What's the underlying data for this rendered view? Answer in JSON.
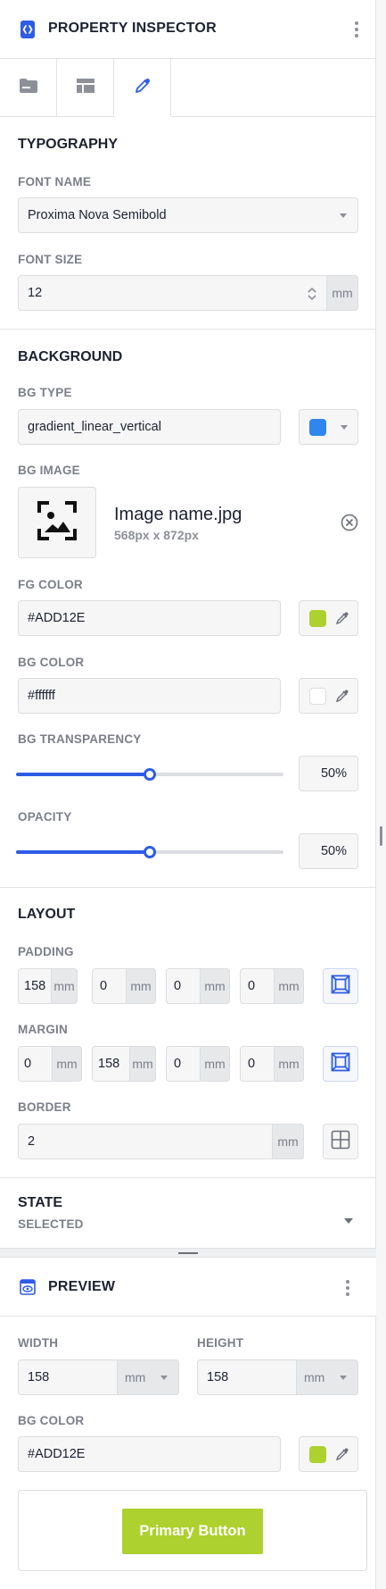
{
  "header": {
    "title": "PROPERTY INSPECTOR"
  },
  "tabs": [
    {
      "icon": "folder-icon",
      "active": false
    },
    {
      "icon": "table-layout-icon",
      "active": false
    },
    {
      "icon": "eyedropper-icon",
      "active": true
    }
  ],
  "typography": {
    "title": "TYPOGRAPHY",
    "font_name_label": "FONT NAME",
    "font_name_value": "Proxima Nova Semibold",
    "font_size_label": "FONT SIZE",
    "font_size_value": "12",
    "font_size_unit": "mm"
  },
  "background": {
    "title": "BACKGROUND",
    "bg_type_label": "BG TYPE",
    "bg_type_value": "gradient_linear_vertical",
    "bg_type_swatch": "#2f86ee",
    "bg_image_label": "BG IMAGE",
    "image_name": "Image name.jpg",
    "image_dims": "568px x 872px",
    "fg_color_label": "FG COLOR",
    "fg_color_value": "#ADD12E",
    "bg_color_label": "BG COLOR",
    "bg_color_value": "#ffffff",
    "bg_transparency_label": "BG TRANSPARENCY",
    "bg_transparency_value": "50%",
    "bg_transparency_level": 0.5,
    "opacity_label": "OPACITY",
    "opacity_value": "50%",
    "opacity_level": 0.5
  },
  "layout": {
    "title": "LAYOUT",
    "padding_label": "PADDING",
    "padding": [
      {
        "value": "158",
        "unit": "mm"
      },
      {
        "value": "0",
        "unit": "mm"
      },
      {
        "value": "0",
        "unit": "mm"
      },
      {
        "value": "0",
        "unit": "mm"
      }
    ],
    "margin_label": "MARGIN",
    "margin": [
      {
        "value": "0",
        "unit": "mm"
      },
      {
        "value": "158",
        "unit": "mm"
      },
      {
        "value": "0",
        "unit": "mm"
      },
      {
        "value": "0",
        "unit": "mm"
      }
    ],
    "border_label": "BORDER",
    "border_value": "2",
    "border_unit": "mm"
  },
  "state": {
    "title": "STATE",
    "value": "SELECTED"
  },
  "preview": {
    "title": "PREVIEW",
    "width_label": "WIDTH",
    "width_value": "158",
    "width_unit": "mm",
    "height_label": "HEIGHT",
    "height_value": "158",
    "height_unit": "mm",
    "bg_color_label": "BG COLOR",
    "bg_color_value": "#ADD12E",
    "button_label": "Primary Button",
    "button_color": "#add12e"
  },
  "colors": {
    "accent": "#2e5ce6",
    "fg_swatch": "#add12e",
    "bg_swatch": "#ffffff"
  }
}
